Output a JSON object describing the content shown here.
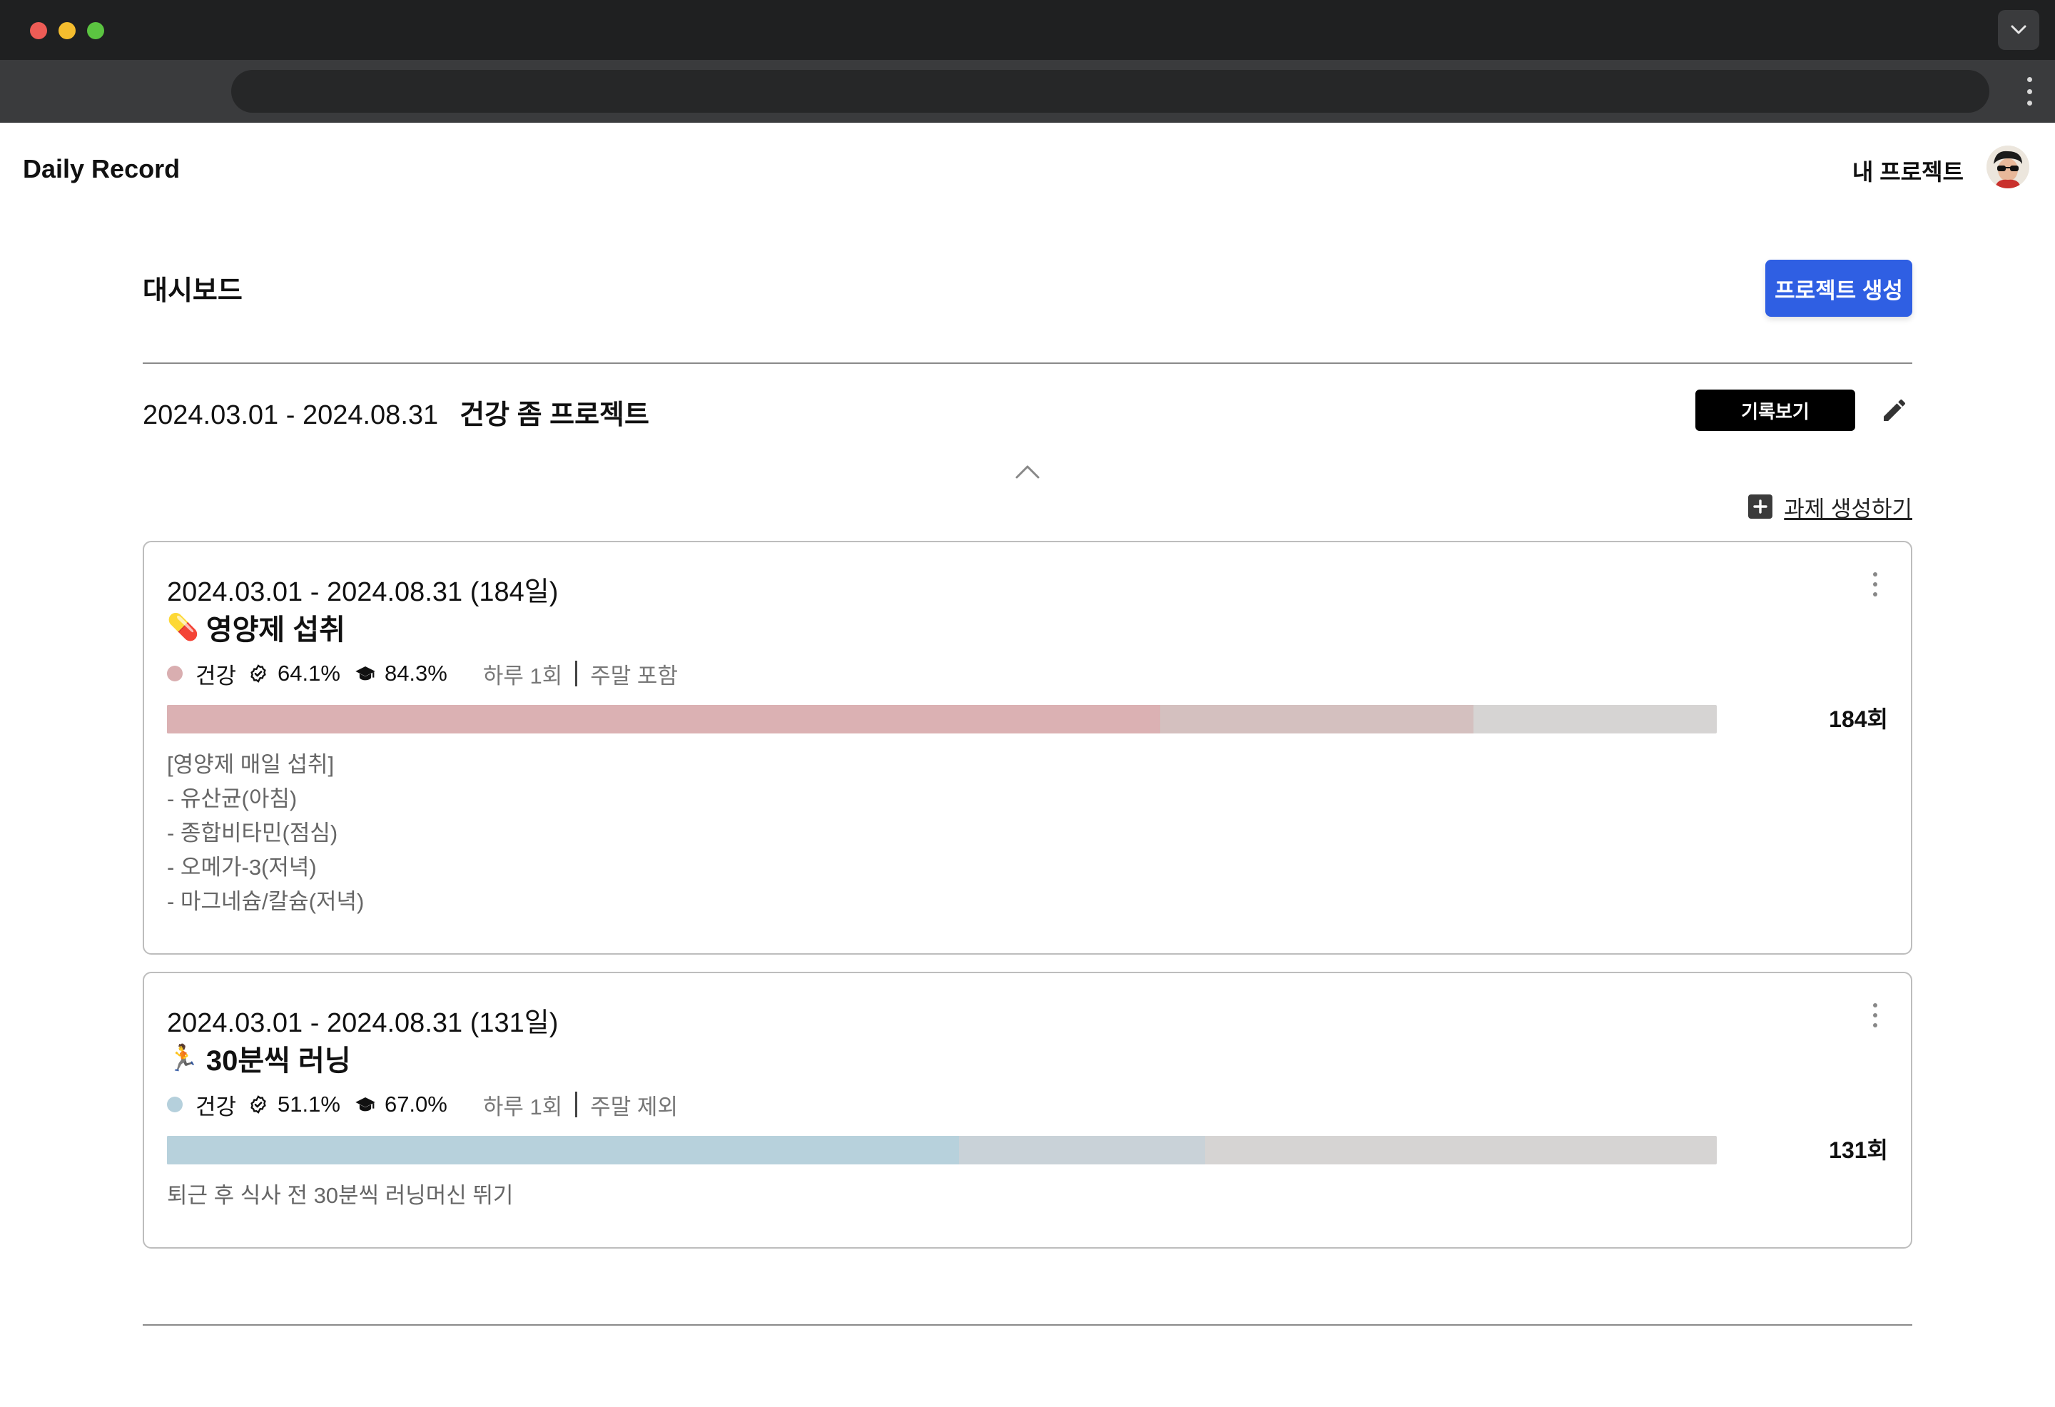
{
  "browser": {
    "address": "",
    "icons": {
      "tab_dropdown": "chevron-down-icon",
      "menu": "vertical-dots-icon"
    }
  },
  "header": {
    "brand": "Daily Record",
    "my_projects": "내 프로젝트",
    "avatar_icon": "user-avatar"
  },
  "dashboard": {
    "title": "대시보드",
    "create_project_label": "프로젝트 생성",
    "accent_color": "#2f5fe3"
  },
  "project": {
    "period": "2024.03.01 - 2024.08.31",
    "name": "건강 좀 프로젝트",
    "view_records_label": "기록보기",
    "edit_icon": "pencil-icon",
    "collapse_icon": "chevron-up-icon",
    "add_task_label": "과제 생성하기",
    "add_task_icon": "plus-square-icon"
  },
  "tasks": [
    {
      "dates": "2024.03.01  -  2024.08.31  (184일)",
      "emoji": "💊",
      "title": "영양제 섭취",
      "category": "건강",
      "category_color": "#d9aeb0",
      "achieved_pct_label": "64.1%",
      "achieved_pct": 64.1,
      "target_pct_label": "84.3%",
      "target_pct": 84.3,
      "frequency": "하루  1회",
      "weekend": "주말 포함",
      "count": "184회",
      "bar_primary_color": "#dbb1b3",
      "bar_secondary_color": "#d4c0bf",
      "description": [
        "[영양제 매일 섭취]",
        "- 유산균(아침)",
        "- 종합비타민(점심)",
        "- 오메가-3(저녁)",
        "- 마그네슘/칼슘(저녁)"
      ]
    },
    {
      "dates": "2024.03.01  -  2024.08.31  (131일)",
      "emoji": "🏃",
      "title": "30분씩 러닝",
      "category": "건강",
      "category_color": "#b5d0dc",
      "achieved_pct_label": "51.1%",
      "achieved_pct": 51.1,
      "target_pct_label": "67.0%",
      "target_pct": 67.0,
      "frequency": "하루  1회",
      "weekend": "주말 제외",
      "count": "131회",
      "bar_primary_color": "#b7d1dc",
      "bar_secondary_color": "#c9d2d8",
      "description": [
        "퇴근 후 식사 전 30분씩 러닝머신 뛰기"
      ]
    }
  ]
}
